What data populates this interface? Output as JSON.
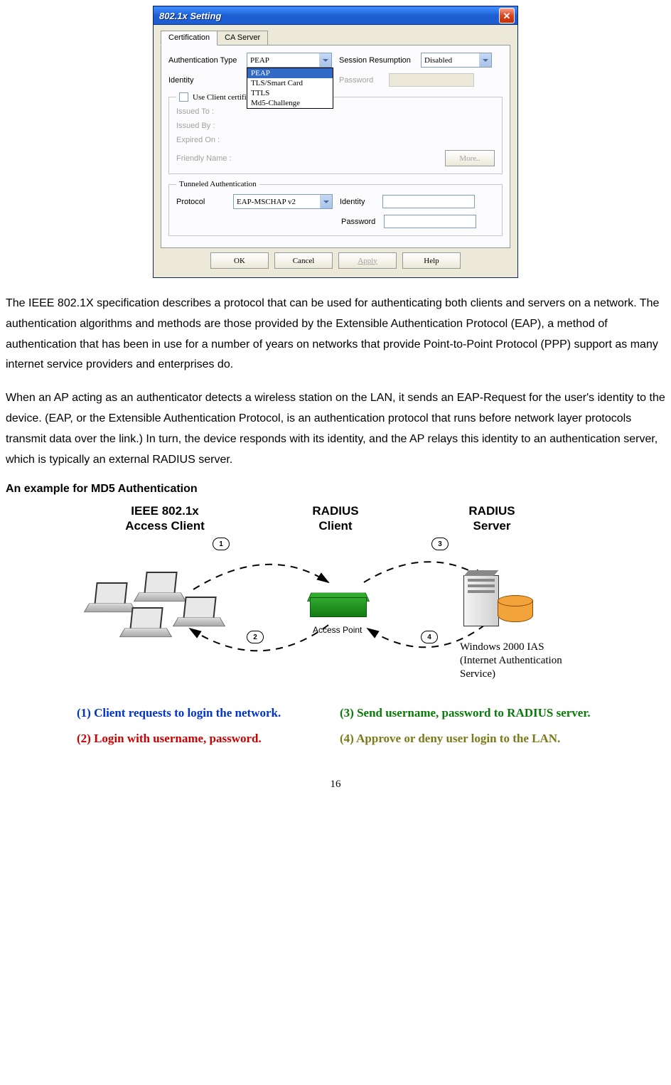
{
  "dialog": {
    "title": "802.1x Setting",
    "tabs": {
      "active": "Certification",
      "other": "CA Server"
    },
    "authTypeLabel": "Authentication Type",
    "authTypeValue": "PEAP",
    "authOptions": [
      "PEAP",
      "TLS/Smart Card",
      "TTLS",
      "Md5-Challenge"
    ],
    "sessionLabel": "Session Resumption",
    "sessionValue": "Disabled",
    "identityLabel": "Identity",
    "passwordLabel": "Password",
    "clientCert": {
      "legend": "Use Client certificate",
      "issuedTo": "Issued To :",
      "issuedBy": "Issued By :",
      "expiredOn": "Expired On :",
      "friendlyName": "Friendly Name :",
      "moreBtn": "More.."
    },
    "tunnel": {
      "legend": "Tunneled Authentication",
      "protocolLabel": "Protocol",
      "protocolValue": "EAP-MSCHAP v2",
      "identityLabel": "Identity",
      "passwordLabel": "Password"
    },
    "buttons": {
      "ok": "OK",
      "cancel": "Cancel",
      "apply": "Apply",
      "help": "Help"
    }
  },
  "para1": "The IEEE 802.1X specification describes a protocol that can be used for authenticating both clients and servers on a network. The authentication algorithms and methods are those provided by the Extensible Authentication Protocol (EAP), a method of authentication that has been in use for a number of years on networks that provide Point-to-Point Protocol (PPP) support as many internet service providers and enterprises do.",
  "para2": "When an AP acting as an authenticator detects a wireless station on the LAN, it sends an EAP-Request for the user's identity to the device. (EAP, or the Extensible Authentication Protocol, is an authentication protocol that runs before network layer protocols transmit data over the link.) In turn, the device responds with its identity, and the AP relays this identity to an authentication server, which is typically an external RADIUS server.",
  "sectionHead": "An example for MD5 Authentication",
  "diagram": {
    "clientLabel": "IEEE 802.1x\nAccess Client",
    "radiusClientLabel": "RADIUS\nClient",
    "radiusServerLabel": "RADIUS\nServer",
    "apLabel": "Access Point",
    "serverNote": "Windows 2000 IAS\n(Internet Authentication\n Service)",
    "nums": {
      "1": "1",
      "2": "2",
      "3": "3",
      "4": "4"
    }
  },
  "steps": {
    "s1": "(1) Client requests to login the network.",
    "s2": "(2) Login with username, password.",
    "s3": "(3) Send username, password to RADIUS server.",
    "s4": "(4) Approve or deny user login to the LAN."
  },
  "pageNumber": "16"
}
